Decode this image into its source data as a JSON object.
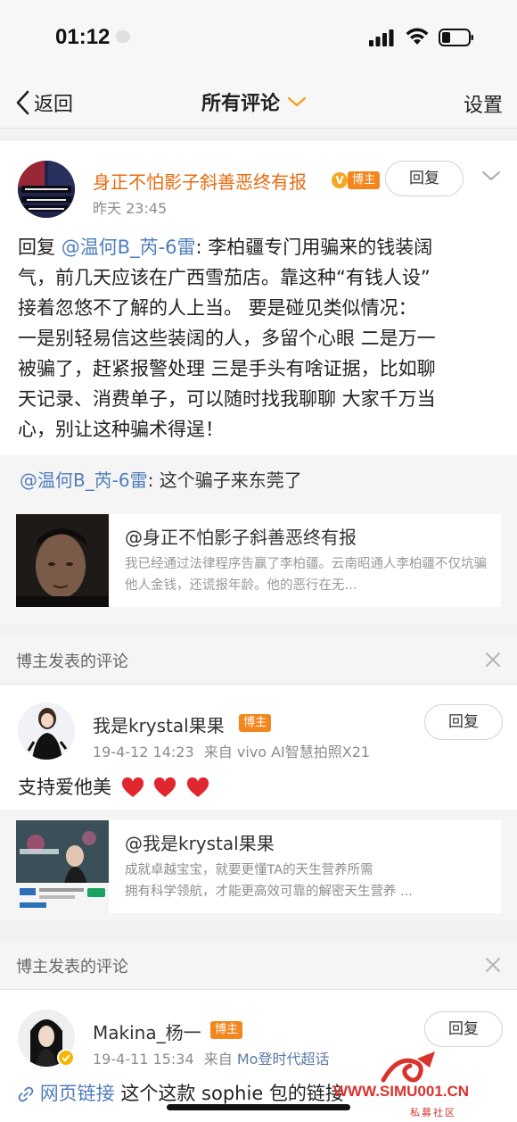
{
  "status_bar": {
    "time": "01:12"
  },
  "nav": {
    "back_label": "返回",
    "title": "所有评论",
    "settings_label": "设置"
  },
  "main_comment": {
    "author": "身正不怕影子斜善恶终有报",
    "vip_icon": "vip-badge-icon",
    "host_badge": "博主",
    "time": "昨天 23:45",
    "reply_button": "回复",
    "avatar_text_top": "行得正不怕影子斜不行不义",
    "avatar_text_bottom": "不扰不惹不做作小人 我心善善恶恶善",
    "reply_prefix": "回复",
    "mention": "@温何B_芮-6雷",
    "text_lines": [
      ": 李柏疆专门用骗来的钱装阔",
      "气，前几天应该在广西雪茄店。靠这种“有钱人设”",
      "接着忽悠不了解的人上当。 要是碰见类似情况：",
      "一是别轻易信这些装阔的人，多留个心眼 二是万一",
      "被骗了，赶紧报警处理 三是手头有啥证据，比如聊",
      "天记录、消费单子，可以随时找我聊聊 大家千万当",
      "心，别让这种骗术得逞！"
    ],
    "quote": {
      "mention": "@温何B_芮-6雷",
      "text": ": 这个骗子来东莞了"
    },
    "link_card": {
      "title": "@身正不怕影子斜善恶终有报",
      "desc": "我已经通过法律程序告赢了李柏疆。云南昭通人李柏疆不仅坑骗他人金钱，还谎报年龄。他的恶行在无..."
    }
  },
  "section1": {
    "title": "博主发表的评论"
  },
  "comment2": {
    "author": "我是krystal果果",
    "host_badge": "博主",
    "date": "19-4-12 14:23",
    "source_prefix": "来自",
    "source": "vivo AI智慧拍照X21",
    "reply_button": "回复",
    "text": "支持爱他美",
    "link_card": {
      "title": "@我是krystal果果",
      "desc_line1": "成就卓越宝宝，就要更懂TA的天生营养所需",
      "desc_line2": "拥有科学领航，才能更高效可靠的解密天生营养 ..."
    }
  },
  "section2": {
    "title": "博主发表的评论"
  },
  "comment3": {
    "author": "Makina_杨一",
    "host_badge": "博主",
    "date": "19-4-11 15:34",
    "source_prefix": "来自",
    "source": "Mo登时代超话",
    "reply_button": "回复",
    "link_label": "网页链接",
    "text": "这个这款 sophie 包的链接"
  },
  "watermark": {
    "text": "WWW.SIMU001.CN",
    "sub": "私募社区"
  },
  "colors": {
    "accent_orange": "#e86b0f",
    "mention_blue": "#4f7dbb",
    "host_badge": "#f3861d"
  }
}
